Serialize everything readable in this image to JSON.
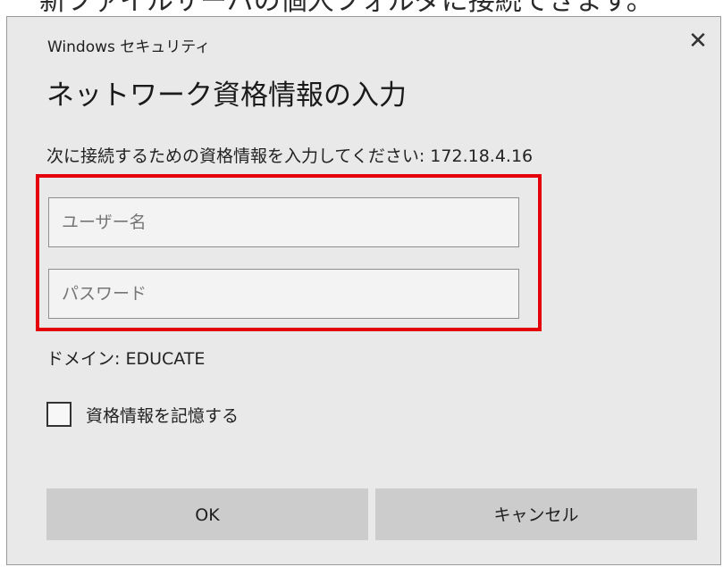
{
  "top_caption": "新ファイルサーバの個人フォルダに接続できます。",
  "dialog": {
    "title": "Windows セキュリティ",
    "close_glyph": "✕",
    "heading": "ネットワーク資格情報の入力",
    "prompt": "次に接続するための資格情報を入力してください: 172.18.4.16",
    "username": {
      "value": "",
      "placeholder": "ユーザー名"
    },
    "password": {
      "value": "",
      "placeholder": "パスワード"
    },
    "domain_label": "ドメイン: EDUCATE",
    "remember": {
      "label": "資格情報を記憶する",
      "checked": false
    },
    "buttons": {
      "ok": "OK",
      "cancel": "キャンセル"
    },
    "highlight_color": "#e3000b"
  }
}
